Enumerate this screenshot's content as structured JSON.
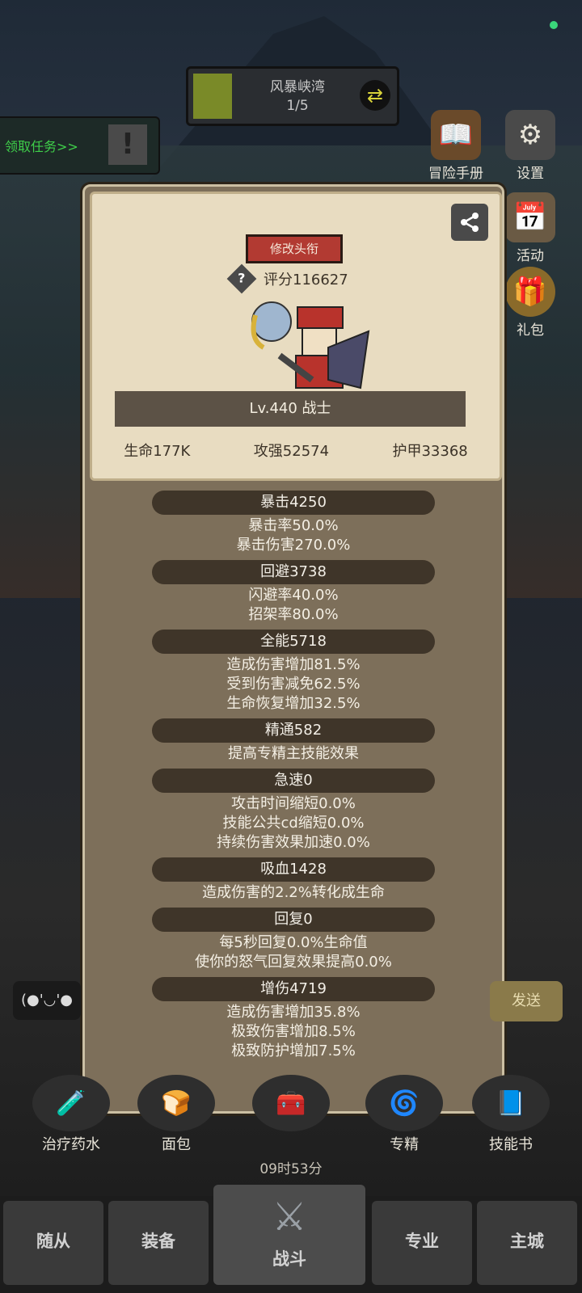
{
  "stage": {
    "name": "风暴峡湾",
    "count": "1/5",
    "refresh_icon": "refresh-icon"
  },
  "quest": {
    "label": "领取任务>>",
    "alert_icon": "exclamation-icon"
  },
  "side_menu": [
    {
      "label": "冒险手册",
      "icon": "book-icon"
    },
    {
      "label": "设置",
      "icon": "gear-icon"
    },
    {
      "label": "活动",
      "icon": "calendar-icon"
    },
    {
      "label": "礼包",
      "icon": "gift-icon"
    }
  ],
  "card": {
    "title_button": "修改头衔",
    "score": "评分116627",
    "level": "Lv.440 战士",
    "stats": [
      "生命177K",
      "攻强52574",
      "护甲33368"
    ],
    "share_icon": "share-icon"
  },
  "attributes": [
    {
      "header": "暴击4250",
      "lines": [
        "暴击率50.0%",
        "暴击伤害270.0%"
      ]
    },
    {
      "header": "回避3738",
      "lines": [
        "闪避率40.0%",
        "招架率80.0%"
      ]
    },
    {
      "header": "全能5718",
      "lines": [
        "造成伤害增加81.5%",
        "受到伤害减免62.5%",
        "生命恢复增加32.5%"
      ]
    },
    {
      "header": "精通582",
      "lines": [
        "提高专精主技能效果"
      ]
    },
    {
      "header": "急速0",
      "lines": [
        "攻击时间缩短0.0%",
        "技能公共cd缩短0.0%",
        "持续伤害效果加速0.0%"
      ]
    },
    {
      "header": "吸血1428",
      "lines": [
        "造成伤害的2.2%转化成生命"
      ]
    },
    {
      "header": "回复0",
      "lines": [
        "每5秒回复0.0%生命值",
        "使你的怒气回复效果提高0.0%"
      ]
    },
    {
      "header": "增伤4719",
      "lines": [
        "造成伤害增加35.8%",
        "极致伤害增加8.5%",
        "极致防护增加7.5%"
      ]
    }
  ],
  "chat": {
    "emote": "(●'◡'●",
    "send": "发送"
  },
  "actions": [
    {
      "label": "治疗药水",
      "icon": "potion-icon"
    },
    {
      "label": "面包",
      "icon": "bread-icon"
    },
    {
      "label": "",
      "icon": "chest-icon"
    },
    {
      "label": "专精",
      "icon": "swirl-icon"
    },
    {
      "label": "技能书",
      "icon": "skillbook-icon"
    }
  ],
  "timer": "09时53分",
  "nav": [
    "随从",
    "装备",
    "战斗",
    "专业",
    "主城"
  ]
}
